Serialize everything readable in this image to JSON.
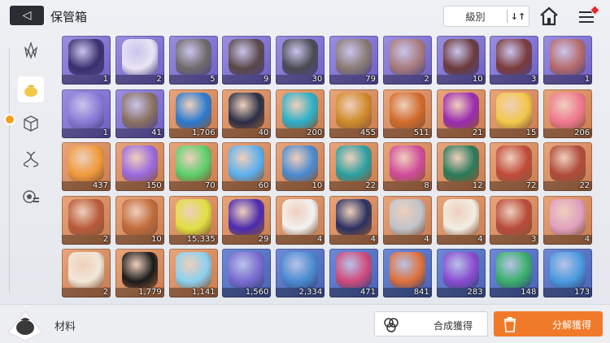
{
  "header": {
    "back_icon": "back-arrow-icon",
    "title": "保管箱",
    "sort_label": "級別",
    "sort_toggle": "↓↑",
    "home_icon": "home-icon",
    "menu_icon": "menu-icon"
  },
  "nav": {
    "items": [
      {
        "name": "crystal-tab",
        "icon": "crystal-icon",
        "active": false
      },
      {
        "name": "materials-tab",
        "icon": "bag-icon",
        "active": true
      },
      {
        "name": "cube-tab",
        "icon": "cube-icon",
        "active": false
      },
      {
        "name": "dna-tab",
        "icon": "dna-icon",
        "active": false
      },
      {
        "name": "list-tab",
        "icon": "list-icon",
        "active": false
      }
    ]
  },
  "grid": {
    "items": [
      {
        "rarity": "purple",
        "count": "1",
        "icon": "card-icon",
        "color": "#3a2e6e"
      },
      {
        "rarity": "purple",
        "count": "2",
        "icon": "scroll-icon",
        "color": "#e9e4f4"
      },
      {
        "rarity": "purple",
        "count": "5",
        "icon": "mask-icon",
        "color": "#6e6a6a"
      },
      {
        "rarity": "purple",
        "count": "9",
        "icon": "brain-icon",
        "color": "#5a4848"
      },
      {
        "rarity": "purple",
        "count": "30",
        "icon": "orb-icon",
        "color": "#4a4a52"
      },
      {
        "rarity": "purple",
        "count": "79",
        "icon": "skull-icon",
        "color": "#8a7a72"
      },
      {
        "rarity": "purple",
        "count": "2",
        "icon": "head-icon",
        "color": "#a87a7a"
      },
      {
        "rarity": "purple",
        "count": "10",
        "icon": "flesh-icon",
        "color": "#6a3a3a"
      },
      {
        "rarity": "purple",
        "count": "3",
        "icon": "mouth-icon",
        "color": "#7a3a3a"
      },
      {
        "rarity": "purple",
        "count": "1",
        "icon": "eye-icon",
        "color": "#b66a6a"
      },
      {
        "rarity": "purple",
        "count": "1",
        "icon": "crystal-head-icon",
        "color": "#8a7ad6"
      },
      {
        "rarity": "purple",
        "count": "41",
        "icon": "mask-icon",
        "color": "#8a7060"
      },
      {
        "rarity": "orange",
        "count": "1,706",
        "icon": "tentacle-icon",
        "color": "#2a7ad0"
      },
      {
        "rarity": "orange",
        "count": "40",
        "icon": "chip-icon",
        "color": "#2a2e46"
      },
      {
        "rarity": "orange",
        "count": "200",
        "icon": "core-icon",
        "color": "#2ab0c8"
      },
      {
        "rarity": "orange",
        "count": "455",
        "icon": "ticket-icon",
        "color": "#d08a2a"
      },
      {
        "rarity": "orange",
        "count": "511",
        "icon": "ticket-icon",
        "color": "#d06a2a"
      },
      {
        "rarity": "orange",
        "count": "21",
        "icon": "eye-orb-icon",
        "color": "#9a2ab0"
      },
      {
        "rarity": "orange",
        "count": "15",
        "icon": "moon-icon",
        "color": "#f2c84a"
      },
      {
        "rarity": "orange",
        "count": "206",
        "icon": "crystal-icon",
        "color": "#f07890"
      },
      {
        "rarity": "orange",
        "count": "437",
        "icon": "crystal-icon",
        "color": "#f09a3a"
      },
      {
        "rarity": "orange",
        "count": "150",
        "icon": "crystal-icon",
        "color": "#9a6ae0"
      },
      {
        "rarity": "orange",
        "count": "70",
        "icon": "crystal-icon",
        "color": "#5ad06a"
      },
      {
        "rarity": "orange",
        "count": "60",
        "icon": "crystal-icon",
        "color": "#5ab0f0"
      },
      {
        "rarity": "orange",
        "count": "10",
        "icon": "book-icon",
        "color": "#4a8ad0"
      },
      {
        "rarity": "orange",
        "count": "22",
        "icon": "book-icon",
        "color": "#2aa0a0"
      },
      {
        "rarity": "orange",
        "count": "8",
        "icon": "book-icon",
        "color": "#d04a9a"
      },
      {
        "rarity": "orange",
        "count": "12",
        "icon": "book-icon",
        "color": "#2a7a5a"
      },
      {
        "rarity": "orange",
        "count": "72",
        "icon": "medal-icon",
        "color": "#c04a3a"
      },
      {
        "rarity": "orange",
        "count": "22",
        "icon": "medal-icon",
        "color": "#b04a3a"
      },
      {
        "rarity": "orange",
        "count": "2",
        "icon": "medal-icon",
        "color": "#b85a3a"
      },
      {
        "rarity": "orange",
        "count": "10",
        "icon": "medal-icon",
        "color": "#c06a3a"
      },
      {
        "rarity": "orange",
        "count": "15,335",
        "icon": "sparkle-icon",
        "color": "#e0e040"
      },
      {
        "rarity": "orange",
        "count": "29",
        "icon": "cube-icon",
        "color": "#4a2ab0"
      },
      {
        "rarity": "orange",
        "count": "4",
        "icon": "sneakers-icon",
        "color": "#f2f2f2"
      },
      {
        "rarity": "orange",
        "count": "4",
        "icon": "book-icon",
        "color": "#2a3060"
      },
      {
        "rarity": "orange",
        "count": "4",
        "icon": "spray-gun-icon",
        "color": "#c0c4cc"
      },
      {
        "rarity": "orange",
        "count": "4",
        "icon": "envelope-icon",
        "color": "#f2eee4"
      },
      {
        "rarity": "orange",
        "count": "3",
        "icon": "dreamcatcher-icon",
        "color": "#b84a3a"
      },
      {
        "rarity": "orange",
        "count": "4",
        "icon": "pick-icon",
        "color": "#e0a0c0"
      },
      {
        "rarity": "orange",
        "count": "2",
        "icon": "scroll-icon",
        "color": "#f2e8d8"
      },
      {
        "rarity": "orange",
        "count": "1,779",
        "icon": "urchin-icon",
        "color": "#1a1a1a"
      },
      {
        "rarity": "orange",
        "count": "1,141",
        "icon": "crystal-cluster-icon",
        "color": "#8ad0f0"
      },
      {
        "rarity": "blue",
        "count": "1,560",
        "icon": "ticket-icon",
        "color": "#7a6ad0"
      },
      {
        "rarity": "blue",
        "count": "2,334",
        "icon": "ticket-icon",
        "color": "#4a8ad0"
      },
      {
        "rarity": "blue",
        "count": "471",
        "icon": "shard-icon",
        "color": "#d04a7a"
      },
      {
        "rarity": "blue",
        "count": "841",
        "icon": "shard-icon",
        "color": "#e0703a"
      },
      {
        "rarity": "blue",
        "count": "283",
        "icon": "shard-icon",
        "color": "#8a4ad0"
      },
      {
        "rarity": "blue",
        "count": "148",
        "icon": "shard-icon",
        "color": "#3ab06a"
      },
      {
        "rarity": "blue",
        "count": "173",
        "icon": "shard-icon",
        "color": "#4a9ae0"
      }
    ]
  },
  "bottom": {
    "category_icon": "bag-icon",
    "category_label": "材料",
    "craft_label": "合成獲得",
    "craft_icon": "craft-icon",
    "dismantle_label": "分解獲得",
    "dismantle_icon": "trash-icon"
  }
}
